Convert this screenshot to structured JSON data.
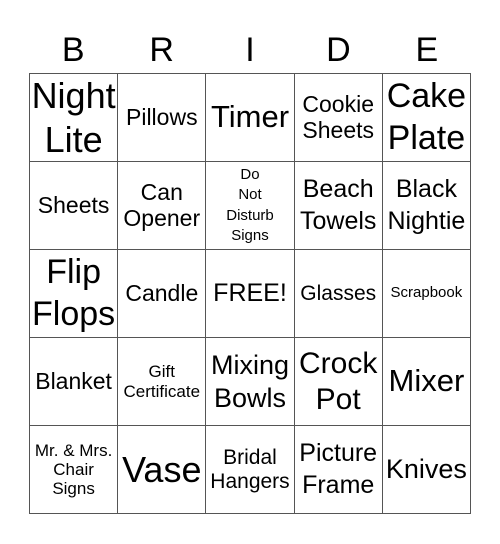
{
  "card": {
    "header": [
      "B",
      "R",
      "I",
      "D",
      "E"
    ],
    "rows": [
      [
        "Night Lite",
        "Pillows",
        "Timer",
        "Cookie Sheets",
        "Cake Plate"
      ],
      [
        "Sheets",
        "Can Opener",
        "Do Not Disturb Signs",
        "Beach Towels",
        "Black Nightie"
      ],
      [
        "Flip Flops",
        "Candle",
        "FREE!",
        "Glasses",
        "Scrapbook"
      ],
      [
        "Blanket",
        "Gift Certificate",
        "Mixing Bowls",
        "Crock Pot",
        "Mixer"
      ],
      [
        "Mr. & Mrs. Chair Signs",
        "Vase",
        "Bridal Hangers",
        "Picture Frame",
        "Knives"
      ]
    ],
    "cell_lines": [
      [
        [
          "Night",
          "Lite"
        ],
        [
          "Pillows"
        ],
        [
          "Timer"
        ],
        [
          "Cookie",
          "Sheets"
        ],
        [
          "Cake",
          "Plate"
        ]
      ],
      [
        [
          "Sheets"
        ],
        [
          "Can",
          "Opener"
        ],
        [
          "Do",
          "Not",
          "Disturb",
          "Signs"
        ],
        [
          "Beach",
          "Towels"
        ],
        [
          "Black",
          "Nightie"
        ]
      ],
      [
        [
          "Flip",
          "Flops"
        ],
        [
          "Candle"
        ],
        [
          "FREE!"
        ],
        [
          "Glasses"
        ],
        [
          "Scrapbook"
        ]
      ],
      [
        [
          "Blanket"
        ],
        [
          "Gift",
          "Certificate"
        ],
        [
          "Mixing",
          "Bowls"
        ],
        [
          "Crock",
          "Pot"
        ],
        [
          "Mixer"
        ]
      ],
      [
        [
          "Mr. & Mrs.",
          "Chair",
          "Signs"
        ],
        [
          "Vase"
        ],
        [
          "Bridal",
          "Hangers"
        ],
        [
          "Picture",
          "Frame"
        ],
        [
          "Knives"
        ]
      ]
    ],
    "free_space": "FREE!",
    "colors": {
      "text": "#000000",
      "grid_line": "#555555",
      "background": "#ffffff"
    }
  }
}
